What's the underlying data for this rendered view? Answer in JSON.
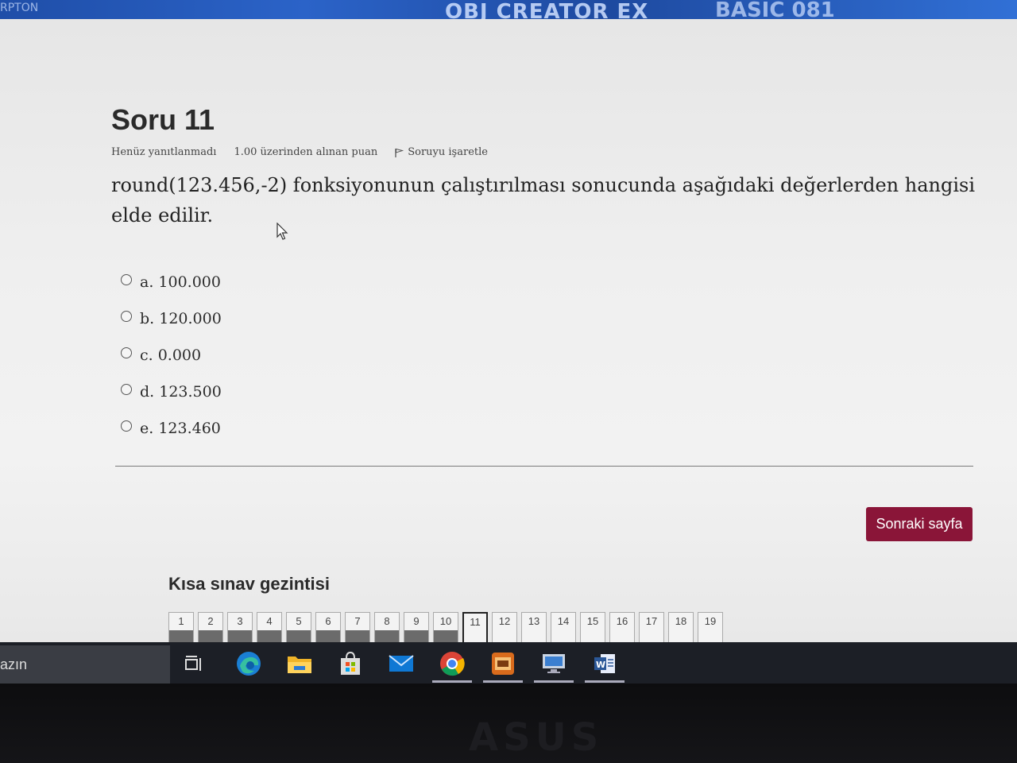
{
  "background": {
    "left_text": "RPTON",
    "center_text": "OBJ CREATOR EX",
    "right_text": "BASIC 081"
  },
  "question": {
    "title": "Soru 11",
    "status": "Henüz yanıtlanmadı",
    "points": "1.00 üzerinden alınan puan",
    "flag_label": "Soruyu işaretle",
    "text": "round(123.456,-2) fonksiyonunun çalıştırılması sonucunda aşağıdaki değerlerden hangisi elde edilir."
  },
  "answers": [
    {
      "label": "a. 100.000"
    },
    {
      "label": "b. 120.000"
    },
    {
      "label": "c. 0.000"
    },
    {
      "label": "d. 123.500"
    },
    {
      "label": "e. 123.460"
    }
  ],
  "next_button": "Sonraki sayfa",
  "quiz_nav": {
    "title": "Kısa sınav gezintisi",
    "current": "11",
    "items": [
      "1",
      "2",
      "3",
      "4",
      "5",
      "6",
      "7",
      "8",
      "9",
      "10",
      "11",
      "12",
      "13",
      "14",
      "15",
      "16",
      "17",
      "18",
      "19"
    ]
  },
  "taskbar": {
    "search_text": "azın",
    "icons": [
      "task-view-icon",
      "edge-icon",
      "file-explorer-icon",
      "store-icon",
      "mail-icon",
      "chrome-icon",
      "app-icon",
      "remote-desktop-icon",
      "word-icon"
    ]
  },
  "colors": {
    "accent": "#8a1538",
    "taskbar": "#1c1f26"
  },
  "brand": "ASUS"
}
